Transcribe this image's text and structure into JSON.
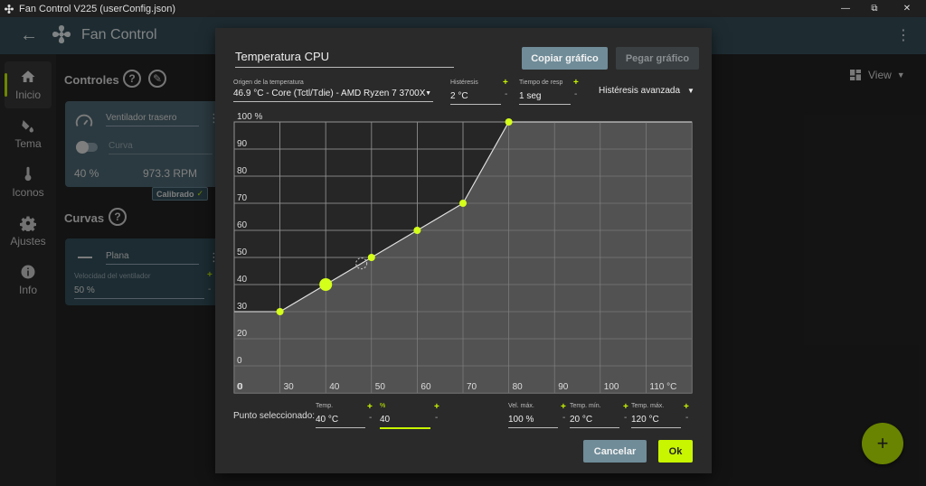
{
  "window": {
    "title": "Fan Control V225 (userConfig.json)",
    "minimize": "—",
    "restore": "⧉",
    "close": "✕"
  },
  "appbar": {
    "title": "Fan Control",
    "back_icon": "arrow-left-icon",
    "more_icon": "more-vert-icon",
    "accent": "#37505c"
  },
  "sidebar": {
    "items": [
      {
        "label": "Inicio",
        "icon": "home-icon",
        "active": true
      },
      {
        "label": "Tema",
        "icon": "paint-bucket-icon",
        "active": false
      },
      {
        "label": "Iconos",
        "icon": "thermometer-icon",
        "active": false
      },
      {
        "label": "Ajustes",
        "icon": "gear-icon",
        "active": false
      },
      {
        "label": "Info",
        "icon": "info-icon",
        "active": false
      }
    ]
  },
  "main": {
    "controles_title": "Controles",
    "curvas_title": "Curvas",
    "help_glyph": "?",
    "view_label": "View",
    "fab_label": "+",
    "control_card": {
      "name": "Ventilador trasero",
      "curve_placeholder": "Curva",
      "percent": "40 %",
      "rpm": "973.3 RPM",
      "badge": "Calibrado"
    },
    "curve_card": {
      "name": "Plana",
      "speed_label": "Velocidad del ventilador",
      "speed_value": "50 %",
      "plus": "+",
      "minus": "-"
    }
  },
  "dialog": {
    "title": "Temperatura CPU",
    "copy_button": "Copiar gráfico",
    "paste_button": "Pegar gráfico",
    "source_label": "Origen de la temperatura",
    "source_value": "46.9 °C - Core (Tctl/Tdie) - AMD Ryzen 7 3700X",
    "hysteresis_label": "Histéresis",
    "hysteresis_value": "2 °C",
    "response_label": "Tiempo de resp",
    "response_value": "1 seg",
    "advanced_hysteresis": "Histéresis avanzada",
    "selected_point_label": "Punto seleccionado:",
    "temp_label": "Temp.",
    "temp_value": "40 °C",
    "pct_label": "%",
    "pct_value": "40",
    "max_speed_label": "Vel. máx.",
    "max_speed_value": "100 %",
    "min_temp_label": "Temp. mín.",
    "min_temp_value": "20 °C",
    "max_temp_label": "Temp. máx.",
    "max_temp_value": "120 °C",
    "plus": "+",
    "minus": "-",
    "cancel_button": "Cancelar",
    "ok_button": "Ok"
  },
  "chart_data": {
    "type": "line",
    "x": [
      20,
      30,
      40,
      50,
      60,
      70,
      80,
      120
    ],
    "y": [
      30,
      30,
      40,
      50,
      60,
      70,
      100,
      100
    ],
    "points": [
      {
        "x": 30,
        "y": 30
      },
      {
        "x": 40,
        "y": 40,
        "selected": true
      },
      {
        "x": 50,
        "y": 50
      },
      {
        "x": 60,
        "y": 60
      },
      {
        "x": 70,
        "y": 70
      },
      {
        "x": 80,
        "y": 100
      }
    ],
    "current_temp_marker": {
      "x": 47.8,
      "y": 47.8
    },
    "x_ticks": [
      "0",
      "30",
      "40",
      "50",
      "60",
      "70",
      "80",
      "90",
      "100",
      "110 °C"
    ],
    "x_tick_values": [
      20,
      30,
      40,
      50,
      60,
      70,
      80,
      90,
      100,
      110
    ],
    "y_ticks": [
      "0",
      "20",
      "30",
      "40",
      "50",
      "60",
      "70",
      "80",
      "90",
      "100 %"
    ],
    "y_tick_values": [
      10,
      20,
      30,
      40,
      50,
      60,
      70,
      80,
      90,
      100
    ],
    "xlim": [
      20,
      120
    ],
    "ylim": [
      0,
      100
    ],
    "grid": true,
    "line_color": "#e0e0e0",
    "point_color": "#d4ff1a",
    "fill_color": "#5b5b5b"
  }
}
